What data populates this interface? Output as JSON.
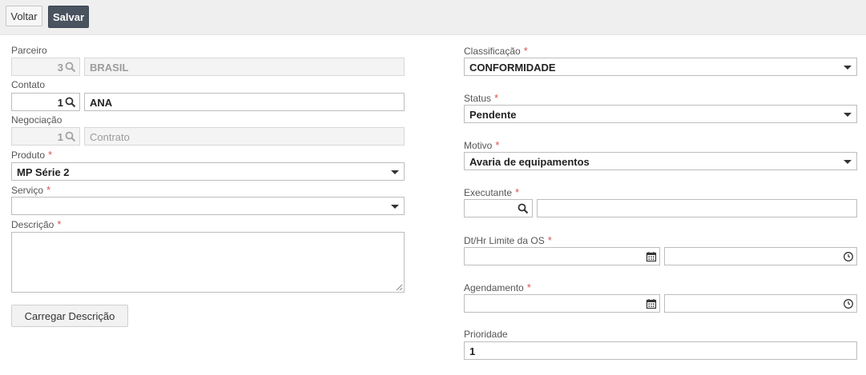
{
  "toolbar": {
    "back_label": "Voltar",
    "save_label": "Salvar"
  },
  "left": {
    "parceiro": {
      "label": "Parceiro",
      "code": "3",
      "name": "BRASIL"
    },
    "contato": {
      "label": "Contato",
      "code": "1",
      "name": "ANA"
    },
    "negociacao": {
      "label": "Negociação",
      "code": "1",
      "name": "Contrato"
    },
    "produto": {
      "label": "Produto",
      "value": "MP Série 2"
    },
    "servico": {
      "label": "Serviço",
      "value": ""
    },
    "descricao": {
      "label": "Descrição",
      "value": ""
    },
    "load_button": "Carregar Descrição"
  },
  "right": {
    "classificacao": {
      "label": "Classificação",
      "value": "CONFORMIDADE"
    },
    "status": {
      "label": "Status",
      "value": "Pendente"
    },
    "motivo": {
      "label": "Motivo",
      "value": "Avaria de equipamentos"
    },
    "executante": {
      "label": "Executante",
      "code": "",
      "name": ""
    },
    "limite": {
      "label": "Dt/Hr Limite da OS",
      "date": "",
      "time": ""
    },
    "agendamento": {
      "label": "Agendamento",
      "date": "",
      "time": ""
    },
    "prioridade": {
      "label": "Prioridade",
      "value": "1"
    }
  },
  "required_mark": "*",
  "colors": {
    "save_button_bg": "#4a5360",
    "required": "#d9534f",
    "toolbar_bg": "#efefef"
  },
  "icons": [
    "search-icon",
    "chevron-down-icon",
    "calendar-icon",
    "clock-icon"
  ]
}
